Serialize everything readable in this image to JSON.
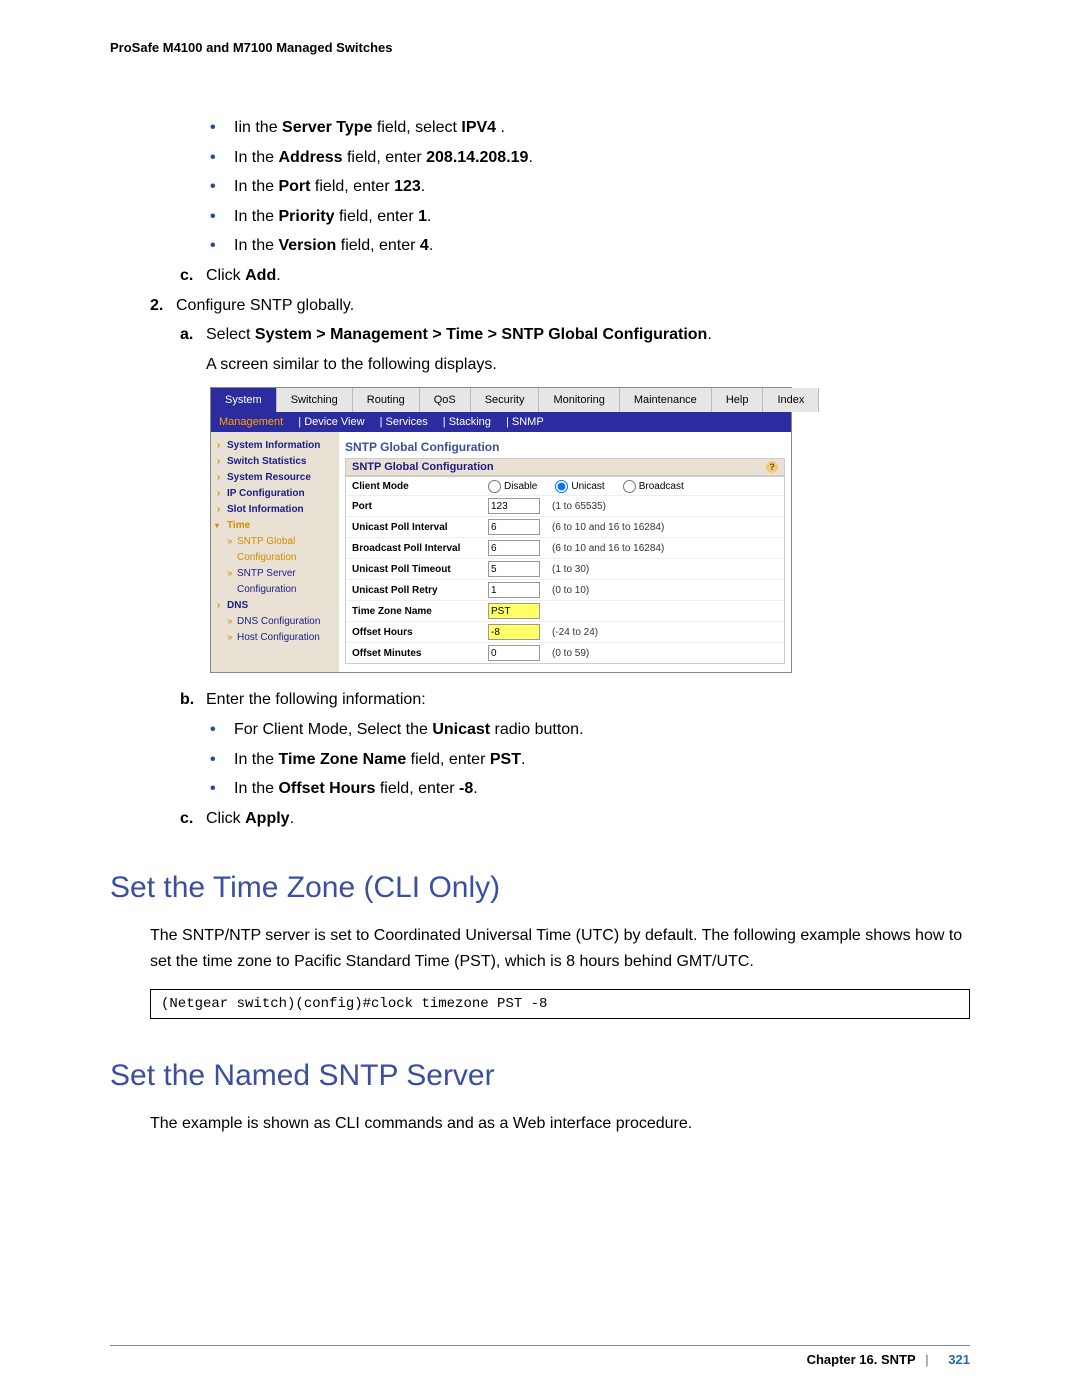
{
  "header": {
    "running": "ProSafe M4100 and M7100 Managed Switches"
  },
  "bullets_top": [
    {
      "pre": "Iin the ",
      "bold1": "Server Type",
      "mid": " field, select ",
      "bold2": "IPV4",
      "post": " ."
    },
    {
      "pre": "In the ",
      "bold1": "Address",
      "mid": " field, enter ",
      "bold2": "208.14.208.19",
      "post": "."
    },
    {
      "pre": "In the ",
      "bold1": "Port",
      "mid": " field, enter ",
      "bold2": "123",
      "post": "."
    },
    {
      "pre": "In the ",
      "bold1": "Priority",
      "mid": " field, enter ",
      "bold2": "1",
      "post": "."
    },
    {
      "pre": "In the ",
      "bold1": "Version",
      "mid": " field, enter ",
      "bold2": "4",
      "post": "."
    }
  ],
  "step_c1": {
    "letter": "c.",
    "pre": "Click ",
    "bold": "Add",
    "post": "."
  },
  "step2": {
    "num": "2.",
    "text": "Configure SNTP globally."
  },
  "step_a2": {
    "letter": "a.",
    "pre": "Select ",
    "bold": "System > Management > Time > SNTP Global Configuration",
    "post": "."
  },
  "step_a2b": "A screen similar to the following displays.",
  "ui": {
    "tabs": [
      "System",
      "Switching",
      "Routing",
      "QoS",
      "Security",
      "Monitoring",
      "Maintenance",
      "Help",
      "Index"
    ],
    "subtabs": [
      "Management",
      "Device View",
      "Services",
      "Stacking",
      "SNMP"
    ],
    "sidenav": {
      "items_top": [
        "System Information",
        "Switch Statistics",
        "System Resource",
        "IP Configuration",
        "Slot Information"
      ],
      "time": "Time",
      "subs": [
        {
          "label": "SNTP Global Configuration",
          "active": true
        },
        {
          "label": "SNTP Server Configuration",
          "active": false
        }
      ],
      "items_bottom": [
        "DNS"
      ],
      "subs2": [
        {
          "label": "DNS Configuration"
        },
        {
          "label": "Host Configuration"
        }
      ]
    },
    "title": "SNTP Global Configuration",
    "panel_title": "SNTP Global Configuration",
    "rows": [
      {
        "label": "Client Mode",
        "type": "radio",
        "options": [
          "Disable",
          "Unicast",
          "Broadcast"
        ],
        "selected": "Unicast"
      },
      {
        "label": "Port",
        "type": "text",
        "value": "123",
        "hint": "(1 to 65535)"
      },
      {
        "label": "Unicast Poll Interval",
        "type": "text",
        "value": "6",
        "hint": "(6 to 10 and 16 to 16284)"
      },
      {
        "label": "Broadcast Poll Interval",
        "type": "text",
        "value": "6",
        "hint": "(6 to 10 and 16 to 16284)"
      },
      {
        "label": "Unicast Poll Timeout",
        "type": "text",
        "value": "5",
        "hint": "(1 to 30)"
      },
      {
        "label": "Unicast Poll Retry",
        "type": "text",
        "value": "1",
        "hint": "(0 to 10)"
      },
      {
        "label": "Time Zone Name",
        "type": "text",
        "value": "PST",
        "hint": "",
        "hl": true
      },
      {
        "label": "Offset Hours",
        "type": "text",
        "value": "-8",
        "hint": "(-24 to 24)",
        "hl": true
      },
      {
        "label": "Offset Minutes",
        "type": "text",
        "value": "0",
        "hint": "(0 to 59)"
      }
    ]
  },
  "step_b2": {
    "letter": "b.",
    "text": "Enter the following information:"
  },
  "bullets_mid": [
    {
      "pre": "For Client Mode, Select the ",
      "bold": "Unicast",
      "post": " radio button."
    },
    {
      "pre": "In the ",
      "bold1": "Time Zone Name",
      "mid": " field, enter ",
      "bold2": "PST",
      "post": "."
    },
    {
      "pre": "In the ",
      "bold1": "Offset Hours",
      "mid": " field, enter ",
      "bold2": "-8",
      "post": "."
    }
  ],
  "step_c2": {
    "letter": "c.",
    "pre": "Click ",
    "bold": "Apply",
    "post": "."
  },
  "h2a": "Set the Time Zone (CLI Only)",
  "para_a": "The SNTP/NTP server is set to Coordinated Universal Time (UTC) by default. The following example shows how to set the time zone to Pacific Standard Time (PST), which is 8 hours behind GMT/UTC.",
  "code_a": "(Netgear switch)(config)#clock timezone PST -8",
  "h2b": "Set the Named SNTP Server",
  "para_b": "The example is shown as CLI commands and as a Web interface procedure.",
  "footer": {
    "chapter": "Chapter 16.  SNTP",
    "page": "321"
  }
}
